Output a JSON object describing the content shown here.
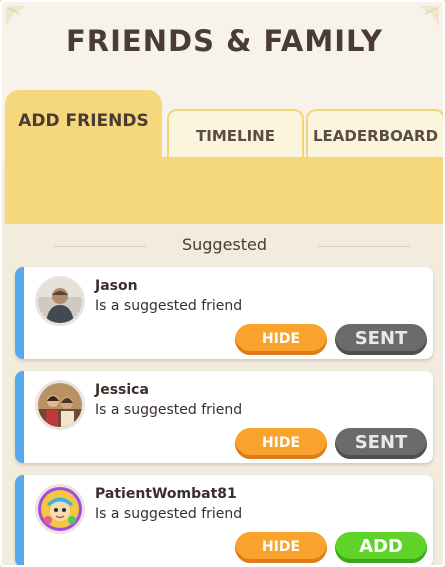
{
  "header": {
    "title": "FRIENDS & FAMILY"
  },
  "tabs": {
    "add_friends": "ADD FRIENDS",
    "timeline": "TIMELINE",
    "leaderboard": "LEADERBOARD",
    "active": "add_friends"
  },
  "section": {
    "heading": "Suggested"
  },
  "friends": [
    {
      "name": "Jason",
      "status": "Is a suggested friend",
      "hide_label": "HIDE",
      "action_label": "SENT",
      "action_state": "sent"
    },
    {
      "name": "Jessica",
      "status": "Is a suggested friend",
      "hide_label": "HIDE",
      "action_label": "SENT",
      "action_state": "sent"
    },
    {
      "name": "PatientWombat81",
      "status": "Is a suggested friend",
      "hide_label": "HIDE",
      "action_label": "ADD",
      "action_state": "add"
    }
  ],
  "colors": {
    "tab_active": "#f6d87c",
    "card_accent": "#58a8ee",
    "hide_button": "#f9a22e",
    "sent_button": "#6b6b6b",
    "add_button": "#5fd32a",
    "title_text": "#4a3b35"
  },
  "icons": {
    "corner_left": "leaf-ornament-icon",
    "corner_right": "leaf-ornament-icon"
  }
}
